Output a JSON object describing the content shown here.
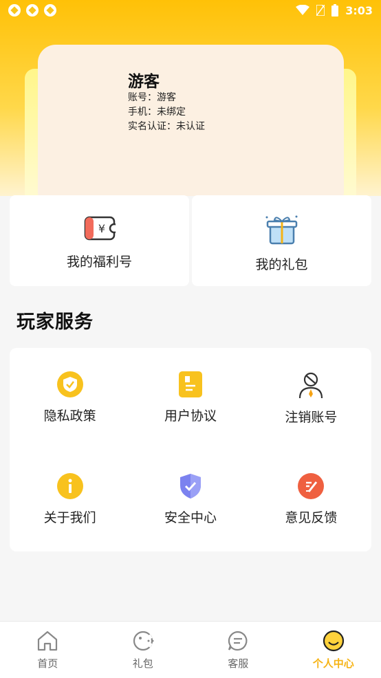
{
  "status": {
    "time": "3:03"
  },
  "profile": {
    "name": "游客",
    "account_label": "账号：",
    "account_value": "游客",
    "phone_label": "手机：",
    "phone_value": "未绑定",
    "realname_label": "实名认证：",
    "realname_value": "未认证"
  },
  "quick": [
    {
      "label": "我的福利号",
      "icon": "coupon-icon"
    },
    {
      "label": "我的礼包",
      "icon": "gift-icon"
    }
  ],
  "section": {
    "title": "玩家服务"
  },
  "services": [
    {
      "label": "隐私政策",
      "icon": "shield-check-icon"
    },
    {
      "label": "用户协议",
      "icon": "document-icon"
    },
    {
      "label": "注销账号",
      "icon": "user-cancel-icon"
    },
    {
      "label": "关于我们",
      "icon": "info-icon"
    },
    {
      "label": "安全中心",
      "icon": "security-shield-icon"
    },
    {
      "label": "意见反馈",
      "icon": "feedback-edit-icon"
    }
  ],
  "tabs": [
    {
      "label": "首页",
      "icon": "home-icon",
      "active": false
    },
    {
      "label": "礼包",
      "icon": "gift-bag-icon",
      "active": false
    },
    {
      "label": "客服",
      "icon": "chat-icon",
      "active": false
    },
    {
      "label": "个人中心",
      "icon": "smile-icon",
      "active": true
    }
  ],
  "colors": {
    "accent": "#f6b314",
    "hero_top": "#ffc107",
    "card": "#fcf0e2"
  }
}
